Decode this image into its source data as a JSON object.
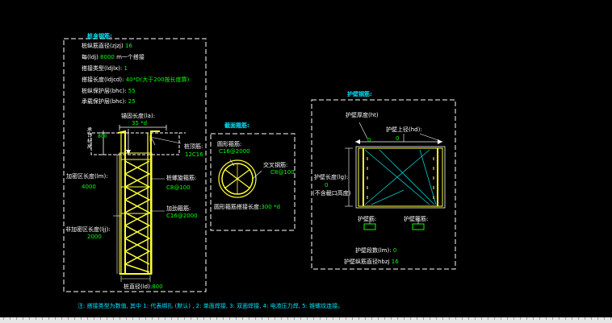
{
  "pile_body": {
    "title": "桩身钢筋:",
    "main_rebar_dia_label": "桩纵筋直径(zjzj)",
    "main_rebar_dia": "16",
    "per_length_label": "每(ldj)",
    "per_length": "8000",
    "per_length_suffix": "m一个搭接",
    "lap_type_label": "搭接类型(ldjlx):",
    "lap_type": "1",
    "lap_length_label": "搭接长度(ldjcd):",
    "lap_length_value": "40*D(大于200按长度算)",
    "pile_cover_label": "桩纵保护层(bhc):",
    "pile_cover": "55",
    "cap_cover_label": "承载保护层(bhc):",
    "cap_cover": "25",
    "anchor_label": "锚固长度(la):",
    "anchor_value": "35 *d",
    "cap_top_label": "承台标高",
    "cap_top_value": "800",
    "pile_top_label": "桩顶筋:",
    "pile_top_value": "12C16",
    "dense_zone_label": "加密区长度(lm):",
    "dense_zone_value": "4000",
    "spiral_label": "桩螺旋箍筋:",
    "spiral_value": "C8@100",
    "stiff_ring_label": "加劲箍筋:",
    "stiff_ring_value": "C16@2000",
    "non_dense_label": "非加密区长度(ljj):",
    "non_dense_value": "2000",
    "pile_dia_label": "桩直径(ld):",
    "pile_dia_value": "800"
  },
  "section": {
    "title": "截面箍筋:",
    "ring_label": "圆形箍筋:",
    "ring_value": "C16@2000",
    "cross_label": "交叉钢筋:",
    "cross_value": "C8@100",
    "lap_label": "圆形箍筋搭接长度:",
    "lap_value": "300 *d"
  },
  "wall": {
    "title": "护壁钢筋:",
    "thickness_label": "护壁厚度(ht)",
    "thickness_value": "0",
    "top_dia_label": "护壁上径(hd):",
    "top_dia_value": "0",
    "length_label": "护壁长度(lg):",
    "length_value": "0",
    "length_note": "(不含截口高度)",
    "rebar_left_label": "护壁筋:",
    "rebar_right_label": "护壁箍筋:",
    "count_label": "护壁段数(lm):",
    "count_value": "0",
    "main_dia_label": "护壁纵筋直径hbzj",
    "main_dia_value": "16"
  },
  "note": "注: 搭接类型为数值, 其中 1: 代表绑扎 (默认) , 2: 单面焊接, 3: 双面焊接, 4: 电渣压力焊, 5: 锥螺纹连接。",
  "colors": {
    "background": "#000000",
    "frame": "#ffffff",
    "label": "#ffffff",
    "title": "#00e5ff",
    "value": "#00ff00",
    "rebar": "#ffff33",
    "stirrup": "#00ff00",
    "cross": "#00cccc",
    "magenta": "#ff00ff"
  }
}
